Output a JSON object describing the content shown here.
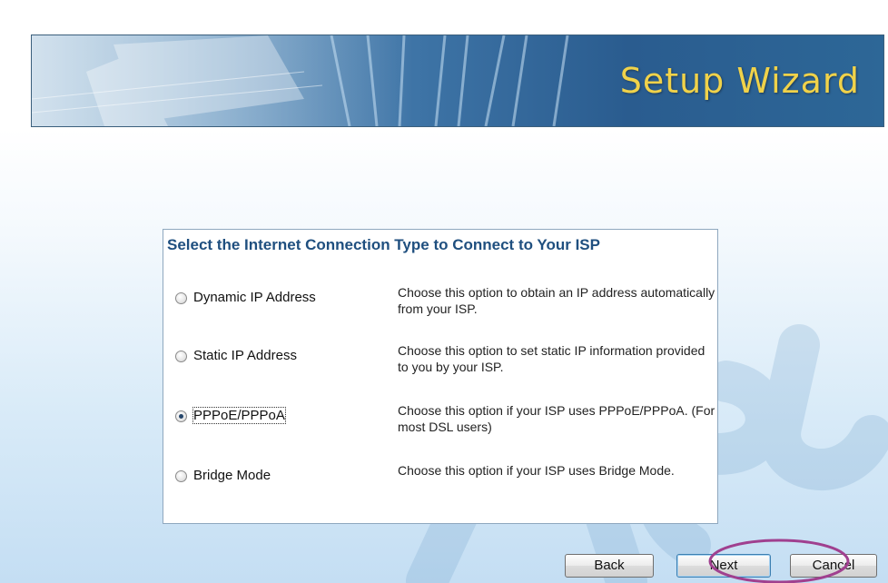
{
  "banner": {
    "title": "Setup Wizard"
  },
  "panel": {
    "title": "Select the Internet Connection Type to Connect to Your ISP",
    "options": [
      {
        "label": "Dynamic IP Address",
        "description": "Choose this option to obtain an IP address automatically from your ISP.",
        "selected": false
      },
      {
        "label": "Static IP Address",
        "description": "Choose this option to set static IP information provided to you by your ISP.",
        "selected": false
      },
      {
        "label": "PPPoE/PPPoA",
        "description": "Choose this option if your ISP uses PPPoE/PPPoA. (For most DSL users)",
        "selected": true
      },
      {
        "label": "Bridge Mode",
        "description": "Choose this option if your ISP uses Bridge Mode.",
        "selected": false
      }
    ]
  },
  "buttons": {
    "back": "Back",
    "next": "Next",
    "cancel": "Cancel"
  },
  "colors": {
    "banner_title": "#f0d24a",
    "panel_title": "#1f4f7f",
    "highlight_ellipse": "#a0408f"
  },
  "icons": {
    "watermark": "asus-logo-watermark",
    "banner_art": "laptop-banner-art"
  }
}
